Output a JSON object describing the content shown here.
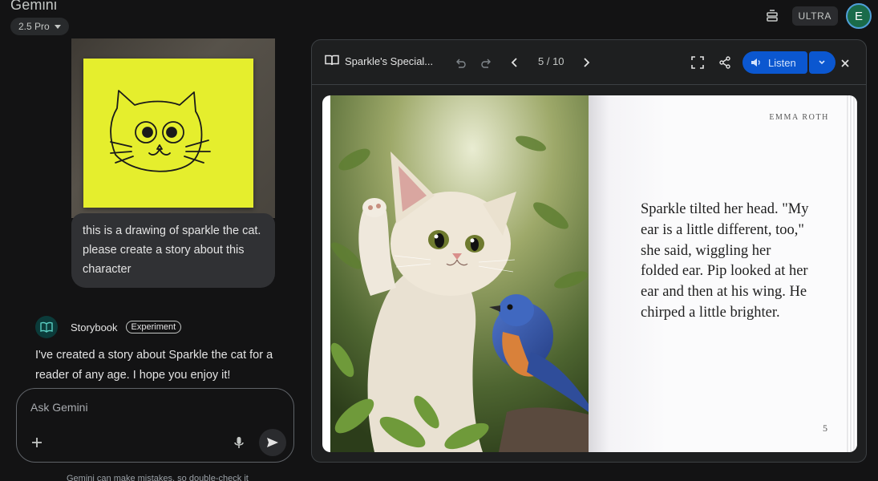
{
  "app": {
    "title": "Gemini",
    "model_label": "2.5 Pro",
    "plan_badge": "ULTRA",
    "avatar_letter": "E"
  },
  "chat": {
    "user_message": "this is a drawing of sparkle the cat. please create a story about this character",
    "agent_name": "Storybook",
    "agent_badge": "Experiment",
    "agent_message": "I've created a story about Sparkle the cat for a reader of any age. I hope you enjoy it!",
    "input_placeholder": "Ask Gemini",
    "disclaimer": "Gemini can make mistakes, so double-check it"
  },
  "storybook": {
    "title": "Sparkle's Special...",
    "page_indicator": "5 / 10",
    "listen_label": "Listen",
    "author": "EMMA ROTH",
    "page_text": "Sparkle tilted her head. \"My ear is a little different, too,\" she said, wiggling her folded ear. Pip looked at her ear and then at his wing. He chirped a little brighter.",
    "page_number": "5"
  },
  "colors": {
    "background": "#131314",
    "accent": "#0b57d0",
    "sticky_note": "#e5ee2d"
  }
}
